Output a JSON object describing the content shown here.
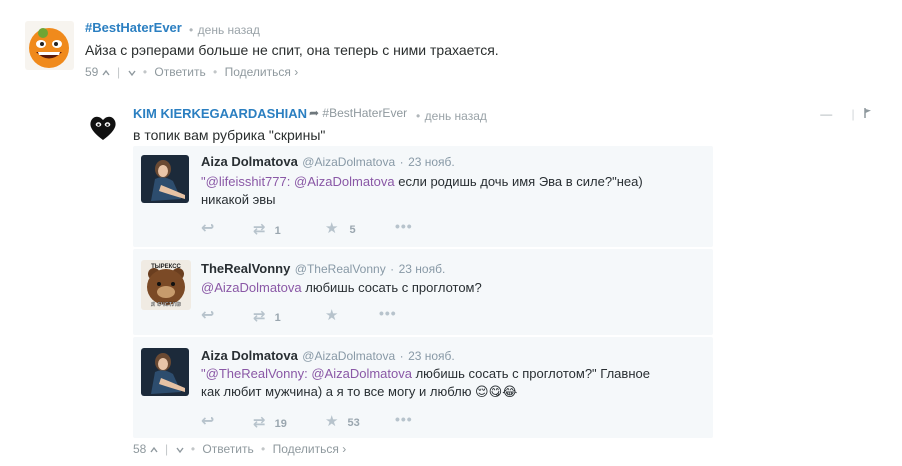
{
  "comment1": {
    "author": "#BestHaterEver",
    "time": "день назад",
    "text": "Айза с рэперами больше не спит, она теперь с ними трахается.",
    "votes": "59",
    "reply_label": "Ответить",
    "share_label": "Поделиться"
  },
  "comment2": {
    "author": "KIM KIERKEGAARDASHIAN",
    "reply_to": "#BestHaterEver",
    "time": "день назад",
    "text": "в топик вам рубрика \"скрины\"",
    "votes": "58",
    "reply_label": "Ответить",
    "share_label": "Поделиться"
  },
  "tweets": [
    {
      "name": "Aiza Dolmatova",
      "handle": "@AizaDolmatova",
      "date": "23 нояб.",
      "line1_mention1": "@lifeisshit777:",
      "line1_mention2": "@AizaDolmatova",
      "line1_rest": "если родишь дочь имя Эва в силе?\"неа)",
      "line2": "никакой эвы",
      "retweets": "1",
      "favorites": "5"
    },
    {
      "name": "TheRealVonny",
      "handle": "@TheRealVonny",
      "date": "23 нояб.",
      "mention": "@AizaDolmatova",
      "text": "любишь сосать с проглотом?",
      "retweets": "1",
      "favorites": "",
      "avatar_caption": "я счстлв",
      "avatar_top": "ТЫРЕКСС"
    },
    {
      "name": "Aiza Dolmatova",
      "handle": "@AizaDolmatova",
      "date": "23 нояб.",
      "line1_mention1": "@TheRealVonny:",
      "line1_mention2": "@AizaDolmatova",
      "line1_rest": "любишь сосать с проглотом?\" Главное",
      "line2": "как любит мужчина) а я то все могу и люблю 😌😋😂",
      "retweets": "19",
      "favorites": "53"
    }
  ]
}
